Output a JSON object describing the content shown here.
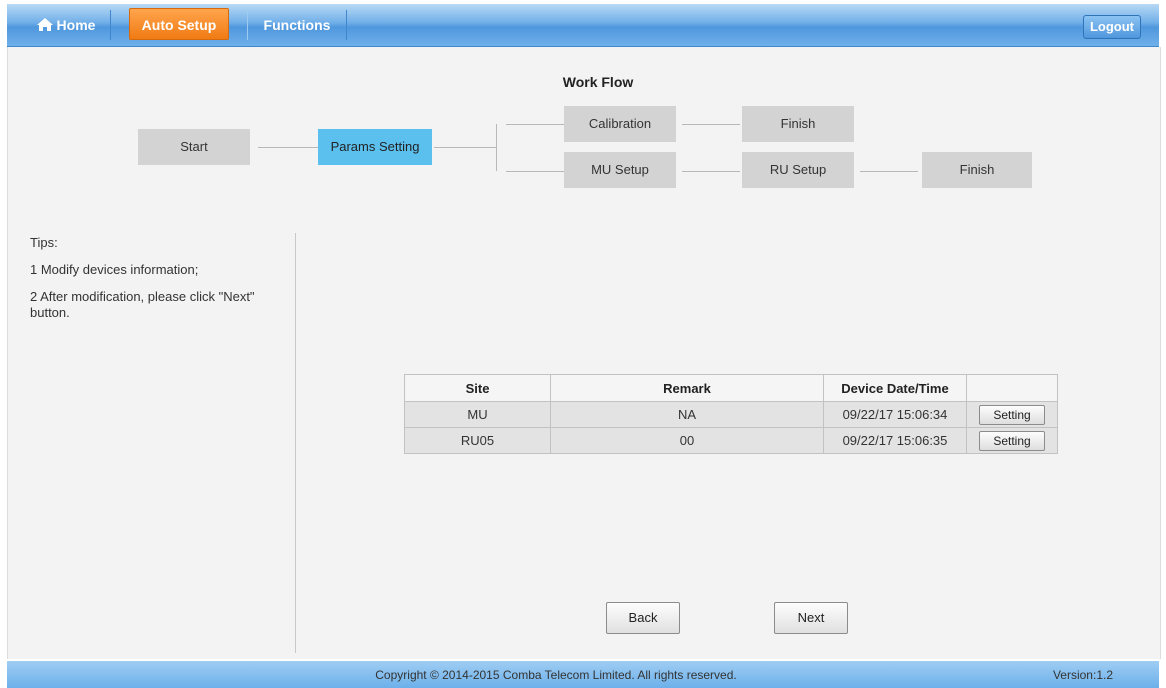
{
  "nav": {
    "home": "Home",
    "auto_setup": "Auto Setup",
    "functions": "Functions",
    "logout": "Logout"
  },
  "workflow": {
    "title": "Work Flow",
    "start": "Start",
    "params_setting": "Params Setting",
    "calibration": "Calibration",
    "finish_top": "Finish",
    "mu_setup": "MU Setup",
    "ru_setup": "RU Setup",
    "finish_bottom": "Finish"
  },
  "tips": {
    "title": "Tips:",
    "line1": "1 Modify devices information;",
    "line2": "2 After modification, please click \"Next\" button."
  },
  "table": {
    "headers": [
      "Site",
      "Remark",
      "Device Date/Time",
      ""
    ],
    "rows": [
      {
        "site": "MU",
        "remark": "NA",
        "datetime": "09/22/17 15:06:34",
        "action": "Setting"
      },
      {
        "site": "RU05",
        "remark": "00",
        "datetime": "09/22/17 15:06:35",
        "action": "Setting"
      }
    ]
  },
  "buttons": {
    "back": "Back",
    "next": "Next"
  },
  "footer": {
    "copyright": "Copyright © 2014-2015 Comba Telecom Limited. All rights reserved.",
    "version": "Version:1.2"
  },
  "colors": {
    "nav_blue": "#4f97dd",
    "active_orange": "#f07b13",
    "active_step": "#5cc0ef",
    "step_gray": "#d3d3d3"
  }
}
